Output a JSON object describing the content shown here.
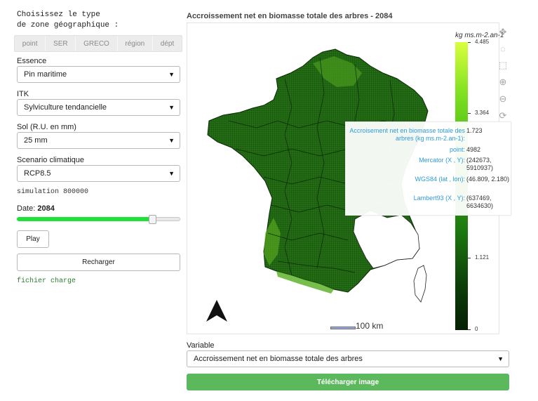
{
  "sidebar": {
    "zone_heading": "Choisissez le type\nde zone géographique :",
    "zone_tabs": [
      "point",
      "SER",
      "GRECO",
      "région",
      "dépt"
    ],
    "essence": {
      "label": "Essence",
      "value": "Pin maritime"
    },
    "itk": {
      "label": "ITK",
      "value": "Sylviculture tendancielle"
    },
    "sol": {
      "label": "Sol (R.U. en mm)",
      "value": "25 mm"
    },
    "scenario": {
      "label": "Scenario climatique",
      "value": "RCP8.5"
    },
    "simulation_text": "simulation 800000",
    "date": {
      "label": "Date:",
      "value": "2084",
      "slider_fraction": 0.83
    },
    "play_label": "Play",
    "reload_label": "Recharger",
    "status_text": "fichier charge"
  },
  "map": {
    "title": "Accroissement net en biomasse totale des arbres - 2084",
    "colorbar": {
      "title": "kg ms.m-2.an-1",
      "ticks": [
        "4.485",
        "3.364",
        "1.121",
        "0"
      ]
    },
    "scale_label": "100 km",
    "tooltip": {
      "rows": [
        {
          "key": "Accroisement net en biomasse totale des arbres (kg ms.m-2.an-1):",
          "value": "1.723"
        },
        {
          "key": "point:",
          "value": "4982"
        },
        {
          "key": "Mercator (X , Y):",
          "value": "(242673, 5910937)"
        },
        {
          "key": "WGS84 (lat , lon):",
          "value": "(46.809, 2.180)"
        },
        {
          "key": "Lambert93 (X , Y):",
          "value": "(637469, 6634630)"
        }
      ]
    },
    "modebar_icons": [
      "pan-icon",
      "lasso-icon",
      "box-select-icon",
      "zoom-in-icon",
      "zoom-out-icon",
      "reset-icon"
    ]
  },
  "bottom": {
    "variable_label": "Variable",
    "variable_value": "Accroissement net en biomasse totale des arbres",
    "download_label": "Télécharger image"
  },
  "colors": {
    "map_dark": "#0f4a0a",
    "map_mid": "#256e14",
    "map_light": "#7fd423",
    "download_button": "#5cb85c",
    "slider_fill": "#22e03a",
    "tooltip_key": "#2e9bd8"
  }
}
